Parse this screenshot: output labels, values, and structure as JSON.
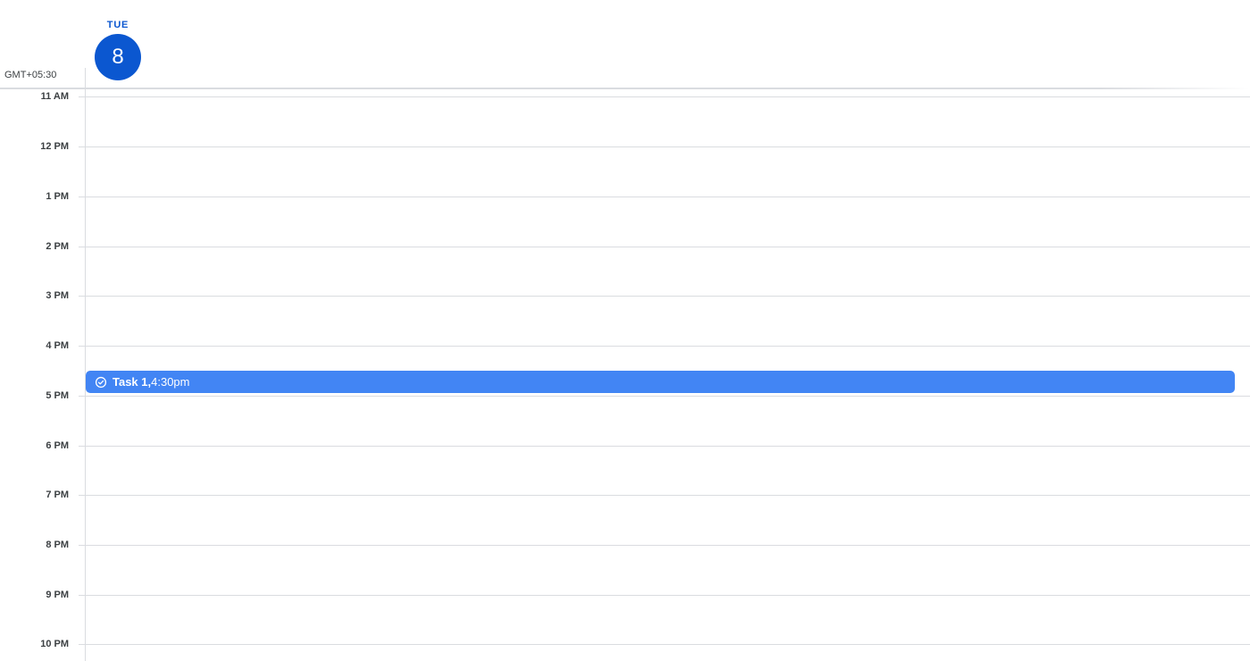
{
  "day": {
    "name": "TUE",
    "number": "8"
  },
  "timezone": "GMT+05:30",
  "hours": [
    "11 AM",
    "12 PM",
    "1 PM",
    "2 PM",
    "3 PM",
    "4 PM",
    "5 PM",
    "6 PM",
    "7 PM",
    "8 PM",
    "9 PM",
    "10 PM"
  ],
  "event": {
    "title": "Task 1,",
    "time": " 4:30pm",
    "icon": "task-check-circle-icon",
    "color": "#4285f4"
  },
  "colors": {
    "accent": "#0b57d0",
    "gridline": "#dadce0"
  }
}
